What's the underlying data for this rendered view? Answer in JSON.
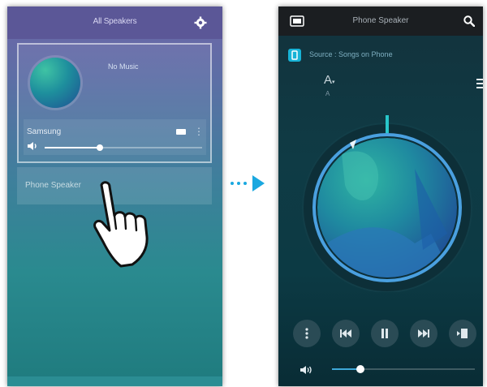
{
  "left_screen": {
    "header": {
      "title": "All Speakers"
    },
    "speaker_card": {
      "now_playing": "No Music",
      "speaker_name": "Samsung",
      "volume": 0.35
    },
    "phone_speaker_label": "Phone Speaker"
  },
  "right_screen": {
    "header": {
      "title": "Phone Speaker"
    },
    "source_text": "Source : Songs on Phone",
    "font_label": "A",
    "font_sub_label": "A",
    "volume": 0.2
  },
  "icons": {
    "back": "back-icon",
    "settings": "gear-icon",
    "search": "search-icon",
    "speakers": "speaker-group-icon",
    "more": "more-vertical-icon",
    "prev": "previous-track-icon",
    "pause": "pause-icon",
    "next": "next-track-icon",
    "add_playlist": "add-to-playlist-icon",
    "volume": "volume-icon",
    "hand": "pointing-hand-icon",
    "arrow": "transition-arrow-icon"
  },
  "colors": {
    "accent": "#17b3d6",
    "left_header": "#5b5797",
    "right_header": "#1b1e21"
  }
}
